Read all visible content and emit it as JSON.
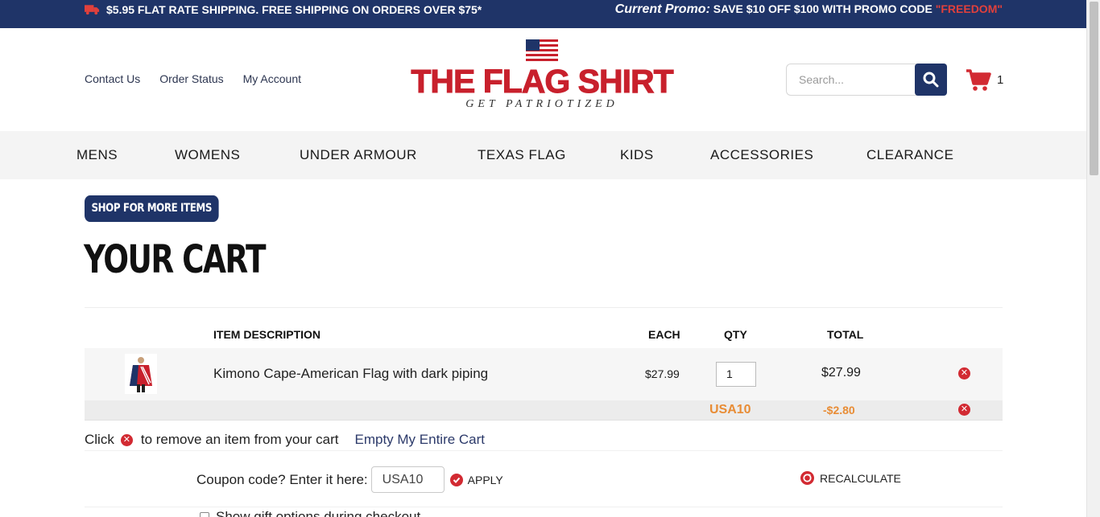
{
  "topbar": {
    "shipping": "$5.95 FLAT RATE SHIPPING. FREE SHIPPING ON ORDERS OVER $75*",
    "promo_label": "Current Promo:",
    "promo_text": "SAVE $10 OFF $100 WITH PROMO CODE",
    "promo_code": "\"FREEDOM\""
  },
  "header": {
    "links": [
      "Contact Us",
      "Order Status",
      "My Account"
    ],
    "brand": "THE FLAG SHIRT",
    "tagline": "GET PATRIOTIZED",
    "search_placeholder": "Search...",
    "cart_count": "1"
  },
  "nav": [
    "MENS",
    "WOMENS",
    "UNDER ARMOUR",
    "TEXAS FLAG",
    "KIDS",
    "ACCESSORIES",
    "CLEARANCE"
  ],
  "content": {
    "shop_more": "SHOP FOR MORE ITEMS",
    "title": "YOUR CART",
    "columns": {
      "desc": "ITEM  DESCRIPTION",
      "each": "EACH",
      "qty": "QTY",
      "total": "TOTAL"
    },
    "item": {
      "desc": "Kimono Cape-American Flag with dark piping",
      "each": "$27.99",
      "qty": "1",
      "total": "$27.99"
    },
    "coupon_row": {
      "code": "USA10",
      "discount": "-$2.80"
    },
    "help": {
      "click": "Click",
      "remove_text": "to remove an item from your cart",
      "empty": "Empty My Entire Cart"
    },
    "coupon": {
      "label": "Coupon code? Enter it here:",
      "value": "USA10",
      "apply": "APPLY",
      "recalculate": "RECALCULATE"
    },
    "gift": "Show gift options during checkout"
  },
  "colors": {
    "navy": "#1f3468",
    "red": "#c8202c",
    "orange": "#e88c35"
  }
}
